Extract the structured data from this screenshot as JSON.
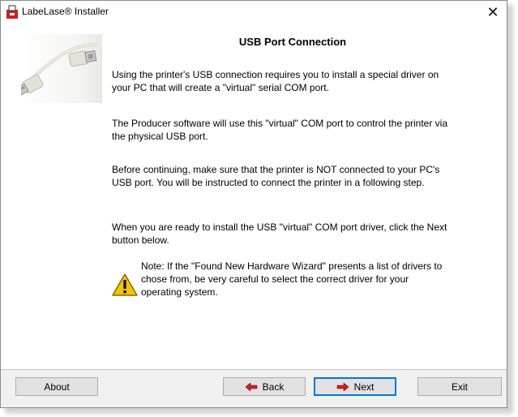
{
  "window": {
    "title": "LabeLase® Installer",
    "close_glyph": "✕"
  },
  "content": {
    "heading": "USB Port Connection",
    "paragraphs": [
      "Using the printer's USB connection requires you to install a special driver on your PC that will create a \"virtual\" serial COM port.",
      "The Producer software will use this \"virtual\" COM port to control the printer via the physical USB port.",
      "Before continuing, make sure that the printer is NOT connected to your PC's USB port.   You will be instructed to connect the printer in a following step.",
      "When you are ready to install the USB \"virtual\" COM port driver, click the Next button below."
    ],
    "note": "Note: If the \"Found New Hardware Wizard\" presents a list of drivers to chose from, be very careful to select the correct driver for your operating system."
  },
  "buttons": {
    "about": "About",
    "back": "Back",
    "next": "Next",
    "exit": "Exit"
  },
  "colors": {
    "arrow": "#cc1f1f",
    "warning_fill": "#f5c400",
    "focus_border": "#0078d7"
  },
  "icons": {
    "app": "labelase-app-icon",
    "warning": "warning-icon",
    "back_arrow": "arrow-left-icon",
    "next_arrow": "arrow-right-icon"
  }
}
